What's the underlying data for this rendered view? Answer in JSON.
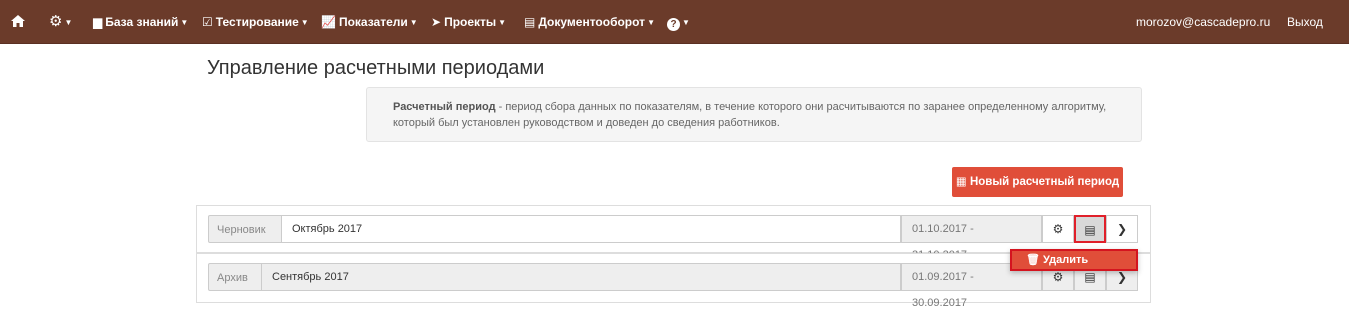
{
  "nav": {
    "home_icon": "home-icon",
    "settings_icon": "gear-icon",
    "knowledge_base": "База знаний",
    "testing": "Тестирование",
    "metrics": "Показатели",
    "projects": "Проекты",
    "documents": "Документооборот",
    "help_icon": "help-icon",
    "user": "morozov@cascadepro.ru",
    "logout": "Выход"
  },
  "page": {
    "title": "Управление расчетными периодами",
    "info_term": "Расчетный период",
    "info_text": " - период сбора данных по показателям, в течение которого они расчитываются по заранее определенному алгоритму, который был установлен руководством и доведен до сведения работников.",
    "new_period_button": "Новый расчетный период"
  },
  "periods": [
    {
      "status": "Черновик",
      "name": "Октябрь 2017",
      "dates": "01.10.2017 - 31.10.2017"
    },
    {
      "status": "Архив",
      "name": "Сентябрь 2017",
      "dates": "01.09.2017 - 30.09.2017"
    }
  ],
  "dropdown": {
    "delete_label": "Удалить"
  },
  "colors": {
    "navbar": "#6b3b2a",
    "accent": "#e04e39",
    "highlight": "#e0202a"
  }
}
